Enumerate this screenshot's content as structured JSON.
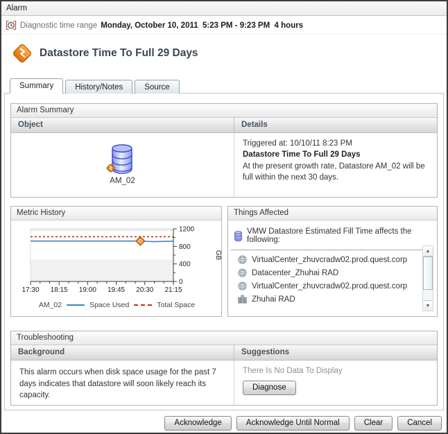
{
  "window": {
    "title": "Alarm"
  },
  "time_range": {
    "label": "Diagnostic time range",
    "value": "Monday, October 10, 2011  5:23 PM - 9:23 PM  4 hours"
  },
  "header": {
    "title": "Datastore Time To Full 29 Days"
  },
  "tabs": [
    {
      "label": "Summary",
      "active": true
    },
    {
      "label": "History/Notes",
      "active": false
    },
    {
      "label": "Source",
      "active": false
    }
  ],
  "alarm_summary": {
    "title": "Alarm Summary",
    "columns": [
      "Object",
      "Details"
    ],
    "object": {
      "name": "AM_02"
    },
    "details": {
      "triggered_at": "Triggered at: 10/10/11 8:23 PM",
      "rule": "Datastore Time To Full 29 Days",
      "description": "At the present growth rate, Datastore AM_02 will be full within the next 30 days."
    }
  },
  "metric_history": {
    "title": "Metric History"
  },
  "chart_data": {
    "type": "line",
    "title": "Metric History",
    "x": [
      "17:30",
      "17:45",
      "18:00",
      "18:15",
      "18:30",
      "18:45",
      "19:00",
      "19:15",
      "19:30",
      "19:45",
      "20:00",
      "20:15",
      "20:30",
      "20:45",
      "21:00",
      "21:15"
    ],
    "x_major_ticks": [
      "17:30",
      "18:15",
      "19:00",
      "19:45",
      "20:30",
      "21:15"
    ],
    "series": [
      {
        "name": "Space Used",
        "color": "#3d85c8",
        "style": "solid",
        "values": [
          921,
          921,
          921,
          921,
          920,
          920,
          920,
          920,
          920,
          920,
          920,
          920,
          916,
          906,
          912,
          918
        ]
      },
      {
        "name": "Total Space",
        "color": "#cc2b16",
        "style": "dashed",
        "values": [
          1020,
          1020,
          1020,
          1020,
          1020,
          1020,
          1020,
          1020,
          1020,
          1020,
          1020,
          1020,
          1020,
          1020,
          1020,
          1020
        ]
      }
    ],
    "marker": {
      "x": "20:23",
      "y": 921,
      "shape": "diamond",
      "color": "#ee8a18"
    },
    "ylabel": "GB",
    "ylim": [
      0,
      1200
    ],
    "yticks": [
      0,
      400,
      800,
      1200
    ],
    "y_minor_ticks": [
      200,
      600,
      1000
    ],
    "legend_prefix": "AM_02",
    "legend_position": "bottom",
    "grid": false,
    "bands": [
      {
        "from": 1150,
        "to": 1200,
        "color": "#ebebeb"
      },
      {
        "from": 0,
        "to": 500,
        "color": "#f1f1f1"
      }
    ]
  },
  "things_affected": {
    "title": "Things Affected",
    "header_text": "VMW Datastore Estimated Fill Time affects the following:",
    "items": [
      {
        "icon": "virtualcenter-globe-icon",
        "label": "VirtualCenter_zhuvcradw02.prod.quest.corp"
      },
      {
        "icon": "datacenter-globe-icon",
        "label": "Datacenter_Zhuhai RAD"
      },
      {
        "icon": "virtualcenter-globe-icon",
        "label": "VirtualCenter_zhuvcradw02.prod.quest.corp"
      },
      {
        "icon": "cluster-icon",
        "label": "Zhuhai RAD"
      }
    ]
  },
  "troubleshooting": {
    "title": "Troubleshooting",
    "columns": [
      "Background",
      "Suggestions"
    ],
    "background_text": "This alarm occurs when disk space usage for the past 7 days indicates that datastore will soon likely reach its capacity.",
    "suggestions": {
      "empty_text": "There Is No Data To Display",
      "diagnose_label": "Diagnose"
    }
  },
  "footer_buttons": [
    "Acknowledge",
    "Acknowledge Until Normal",
    "Clear",
    "Cancel"
  ],
  "colors": {
    "severity_warning_orange": "#ee8a18",
    "chart_used_blue": "#3d85c8",
    "chart_total_red": "#cc2b16",
    "heading_slate": "#3a4652",
    "datastore_blue": "#4250c8"
  }
}
